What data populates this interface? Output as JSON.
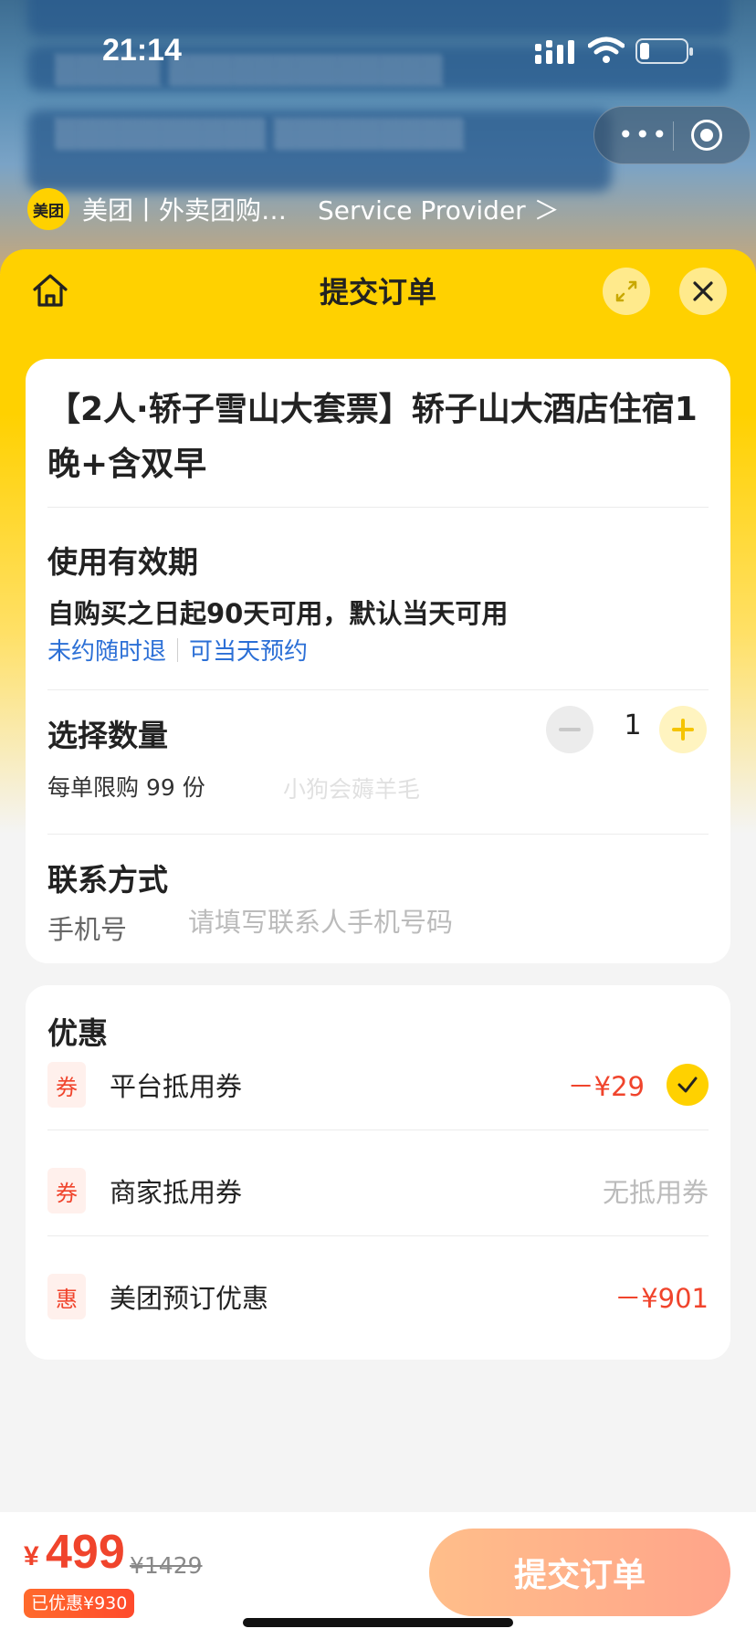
{
  "status_bar": {
    "time": "21:14"
  },
  "provider": {
    "logo_text": "美团",
    "name": "美团丨外卖团购…",
    "link": "Service Provider ＞"
  },
  "sheet": {
    "title": "提交订单"
  },
  "product": {
    "title": "【2人·轿子雪山大套票】轿子山大酒店住宿1晚+含双早"
  },
  "validity": {
    "label": "使用有效期",
    "text": "自购买之日起90天可用，默认当天可用",
    "tags": [
      "未约随时退",
      "可当天预约"
    ]
  },
  "quantity": {
    "label": "选择数量",
    "value": "1",
    "limit": "每单限购 99 份",
    "watermark": "小狗会薅羊毛"
  },
  "contact": {
    "label": "联系方式",
    "phone_label": "手机号",
    "phone_placeholder": "请填写联系人手机号码",
    "phone_value": ""
  },
  "discounts": {
    "title": "优惠",
    "items": [
      {
        "icon": "券",
        "label": "平台抵用券",
        "value": "－¥29",
        "checked": true
      },
      {
        "icon": "券",
        "label": "商家抵用券",
        "value": "无抵用券"
      },
      {
        "icon": "惠",
        "label": "美团预订优惠",
        "value": "－¥901"
      }
    ]
  },
  "checkout": {
    "currency": "¥",
    "price": "499",
    "original_price": "¥1429",
    "saved": "已优惠¥930",
    "submit_label": "提交订单"
  },
  "colors": {
    "brand_yellow": "#ffd100",
    "price_red": "#f0442c",
    "link_blue": "#2b6fd6",
    "submit_gradient_start": "#ffbe8a",
    "submit_gradient_end": "#ffa48a"
  }
}
